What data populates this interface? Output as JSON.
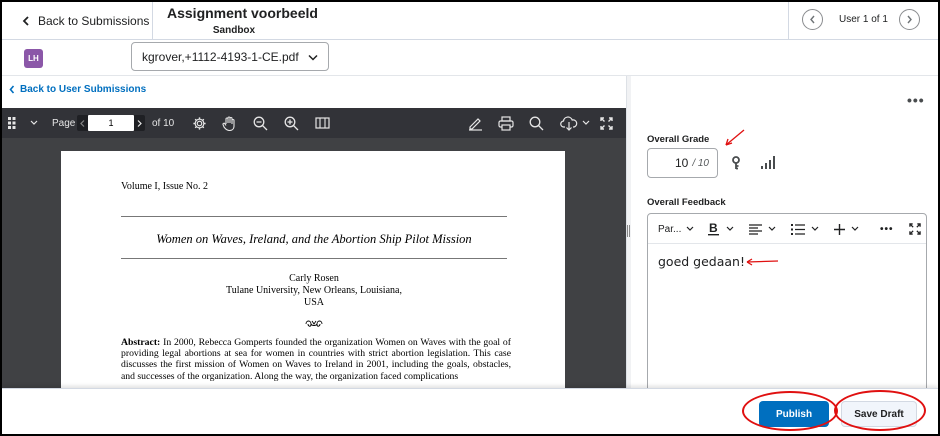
{
  "header": {
    "back_label": "Back to Submissions",
    "title": "Assignment voorbeeld",
    "subtitle": "Sandbox",
    "user_count": "User 1 of 1"
  },
  "user": {
    "initials": "LH",
    "avatar_color": "#8b57a8"
  },
  "file_select": {
    "value": "kgrover,+1112-4193-1-CE.pdf"
  },
  "left": {
    "back_user_label": "Back to User Submissions"
  },
  "viewer": {
    "page_label": "Page",
    "page_value": "1",
    "page_total": "of 10",
    "icons": [
      "thumbnails-icon",
      "settings-icon",
      "hand-icon",
      "zoom-out-icon",
      "zoom-in-icon",
      "two-page-icon",
      "annotate-icon",
      "print-icon",
      "search-icon",
      "download-icon",
      "fullscreen-icon"
    ]
  },
  "pdf": {
    "issue": "Volume I, Issue No. 2",
    "title": "Women on Waves, Ireland, and the Abortion Ship Pilot Mission",
    "author_name": "Carly Rosen",
    "author_affil": "Tulane University, New Orleans, Louisiana,",
    "author_country": "USA",
    "abstract_label": "Abstract:",
    "abstract_text": " In 2000, Rebecca Gomperts founded the organization Women on Waves with the goal of providing legal abortions at sea for women in countries with strict abortion legislation. This case discusses the first mission of Women on Waves to Ireland in 2001, including the goals, obstacles, and successes of the organization. Along the way, the organization faced complications"
  },
  "grading": {
    "grade_label": "Overall Grade",
    "grade_value": "10",
    "grade_out_of": "/ 10",
    "feedback_label": "Overall Feedback",
    "feedback_text": "goed gedaan!",
    "editor_format": "Par..."
  },
  "footer": {
    "publish_label": "Publish",
    "draft_label": "Save Draft"
  },
  "colors": {
    "accent": "#006fbf",
    "annotation": "#e01010"
  }
}
